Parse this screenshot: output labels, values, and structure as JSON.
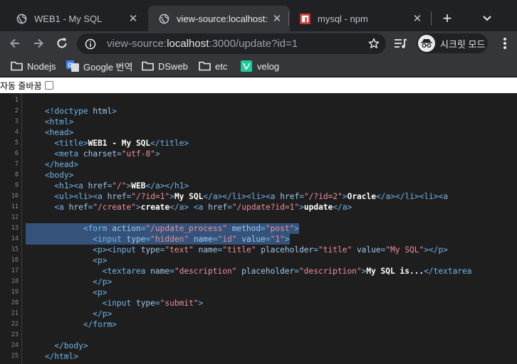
{
  "tabs": [
    {
      "title": "WEB1 - My SQL",
      "active": false
    },
    {
      "title": "view-source:localhost:3000/update?id=1",
      "active": true
    },
    {
      "title": "mysql - npm",
      "active": false
    }
  ],
  "toolbar": {
    "url_scheme": "view-source:",
    "url_host": "localhost",
    "url_rest": ":3000/update?id=1",
    "incognito_label": "시크릿 모드"
  },
  "bookmarks": [
    {
      "label": "Nodejs",
      "icon": "folder-icon"
    },
    {
      "label": "Google 번역",
      "icon": "google-translate-icon"
    },
    {
      "label": "DSweb",
      "icon": "folder-icon"
    },
    {
      "label": "etc",
      "icon": "folder-icon"
    },
    {
      "label": "velog",
      "icon": "velog-icon"
    }
  ],
  "wrap_bar": {
    "label": "자동 줄바꿈"
  },
  "colors": {
    "tag": "#6fb5e8",
    "attribute": "#9ec9ea",
    "value": "#ec8e9a",
    "selection": "#35537a"
  },
  "source": {
    "lines": [
      {
        "n": "1",
        "code": ""
      },
      {
        "n": "2",
        "code": "    <!doctype html>"
      },
      {
        "n": "3",
        "code": "    <html>"
      },
      {
        "n": "4",
        "code": "    <head>"
      },
      {
        "n": "5",
        "code": "      <title>WEB1 - My SQL</title>"
      },
      {
        "n": "6",
        "code": "      <meta charset=\"utf-8\">"
      },
      {
        "n": "7",
        "code": "    </head>"
      },
      {
        "n": "8",
        "code": "    <body>"
      },
      {
        "n": "9",
        "code": "      <h1><a href=\"/\">WEB</a></h1>"
      },
      {
        "n": "10",
        "code": "      <ul><li><a href=\"/?id=1\">My SQL</a></li><li><a href=\"/?id=2\">Oracle</a></li><li><a"
      },
      {
        "n": "11",
        "code": "      <a href=\"/create\">create</a> <a href=\"/update?id=1\">update</a>"
      },
      {
        "n": "12",
        "code": ""
      },
      {
        "n": "13",
        "code": "            <form action=\"/update_process\" method=\"post\">"
      },
      {
        "n": "14",
        "code": "              <input type=\"hidden\" name=\"id\" value=\"1\">"
      },
      {
        "n": "15",
        "code": "              <p><input type=\"text\" name=\"title\" placeholder=\"title\" value=\"My SQL\"></p>"
      },
      {
        "n": "16",
        "code": "              <p>"
      },
      {
        "n": "17",
        "code": "                <textarea name=\"description\" placeholder=\"description\">My SQL is...</textarea"
      },
      {
        "n": "18",
        "code": "              </p>"
      },
      {
        "n": "19",
        "code": "              <p>"
      },
      {
        "n": "20",
        "code": "                <input type=\"submit\">"
      },
      {
        "n": "21",
        "code": "              </p>"
      },
      {
        "n": "22",
        "code": "            </form>"
      },
      {
        "n": "23",
        "code": ""
      },
      {
        "n": "24",
        "code": "      </body>"
      },
      {
        "n": "25",
        "code": "    </html>"
      }
    ]
  }
}
